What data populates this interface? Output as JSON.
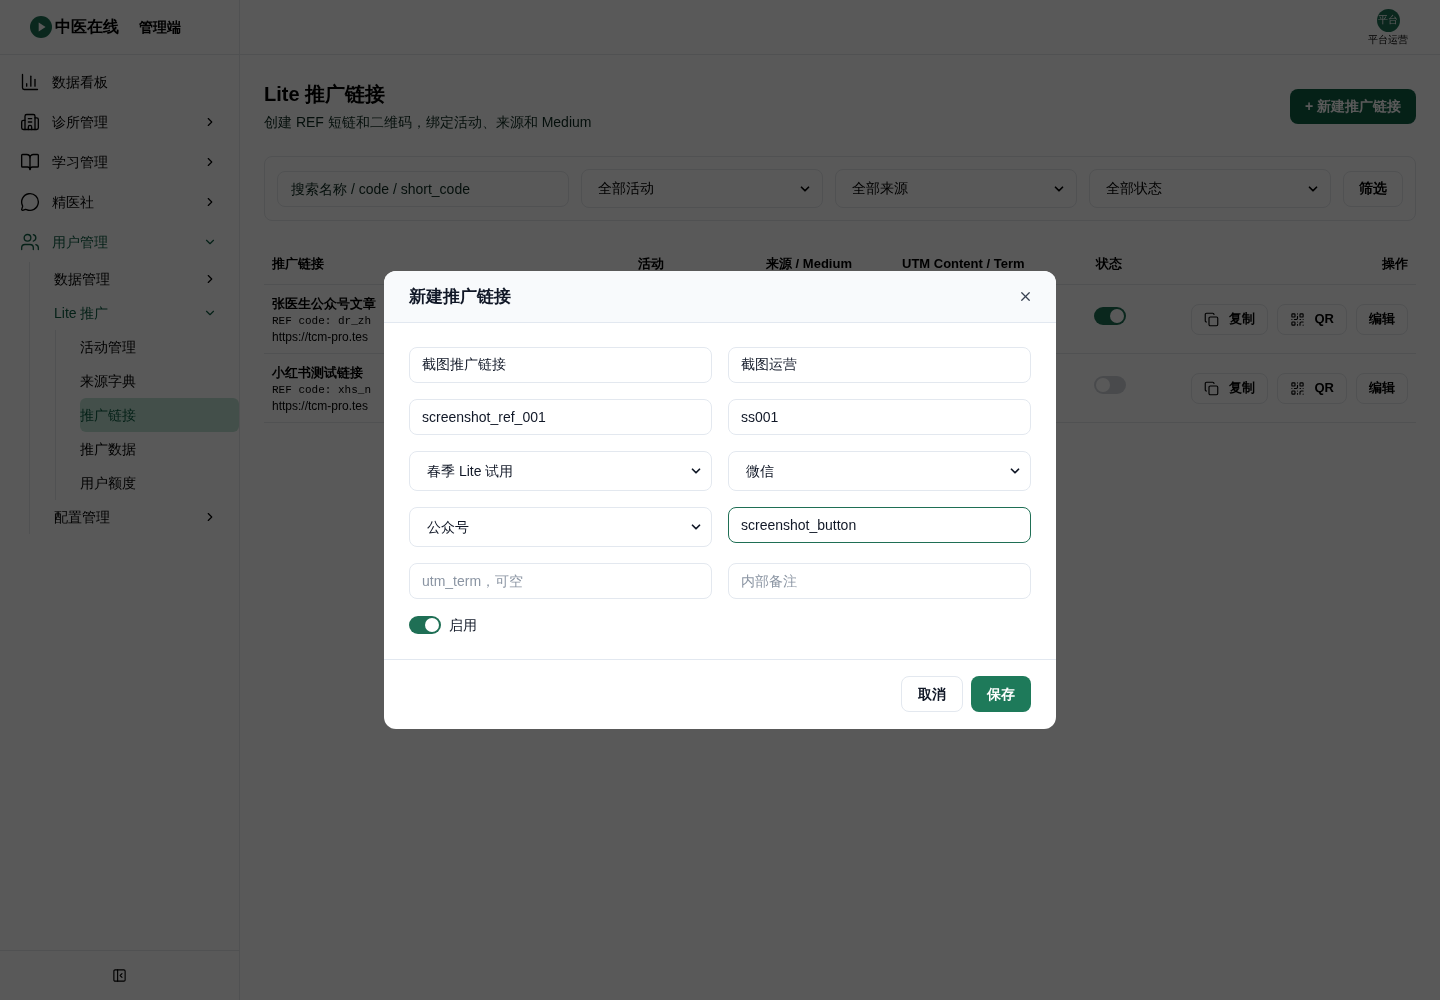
{
  "brand": {
    "name": "中医在线",
    "suffix": "管理端"
  },
  "user": {
    "avatar": "平台",
    "name": "平台运营"
  },
  "sidebar": {
    "items": [
      {
        "label": "数据看板",
        "selected": false
      },
      {
        "label": "诊所管理",
        "selected": false,
        "expanded": false
      },
      {
        "label": "学习管理",
        "selected": false,
        "expanded": false
      },
      {
        "label": "精医社",
        "selected": false,
        "expanded": false
      },
      {
        "label": "用户管理",
        "selected": false,
        "expanded": true,
        "children": [
          {
            "label": "数据管理",
            "selected": false,
            "expanded": false
          },
          {
            "label": "Lite 推广",
            "selected": false,
            "expanded": true,
            "children": [
              {
                "label": "活动管理",
                "selected": false
              },
              {
                "label": "来源字典",
                "selected": false
              },
              {
                "label": "推广链接",
                "selected": true
              },
              {
                "label": "推广数据",
                "selected": false
              },
              {
                "label": "用户额度",
                "selected": false
              }
            ]
          },
          {
            "label": "配置管理",
            "selected": false,
            "expanded": false
          }
        ]
      }
    ]
  },
  "page": {
    "title": "Lite 推广链接",
    "subtitle": "创建 REF 短链和二维码，绑定活动、来源和 Medium",
    "new_button": "+ 新建推广链接"
  },
  "filters": {
    "search": {
      "placeholder": "搜索名称 / code / short_code"
    },
    "selects": [
      "全部活动",
      "全部来源",
      "全部状态"
    ],
    "button": "筛选"
  },
  "table": {
    "columns": [
      "推广链接",
      "活动",
      "来源 / Medium",
      "UTM Content / Term",
      "状态",
      "操作"
    ],
    "rows": [
      {
        "title": "张医生公众号文章",
        "ref_code": "REF code: dr_zh",
        "url": "https://tcm-pro.tes",
        "enabled": true,
        "actions": [
          {
            "kind": "copy",
            "label": "复制"
          },
          {
            "kind": "qr",
            "label": "QR"
          },
          {
            "kind": "edit",
            "label": "编辑"
          }
        ]
      },
      {
        "title": "小红书测试链接",
        "ref_code": "REF code: xhs_n",
        "url": "https://tcm-pro.tes",
        "enabled": false,
        "actions": [
          {
            "kind": "copy",
            "label": "复制"
          },
          {
            "kind": "qr",
            "label": "QR"
          },
          {
            "kind": "edit",
            "label": "编辑"
          }
        ]
      }
    ]
  },
  "modal": {
    "title": "新建推广链接",
    "fields": [
      {
        "kind": "input",
        "value": "截图推广链接",
        "focused": false
      },
      {
        "kind": "input",
        "value": "截图运营",
        "focused": false
      },
      {
        "kind": "input",
        "value": "screenshot_ref_001",
        "focused": false
      },
      {
        "kind": "input",
        "value": "ss001",
        "focused": false
      },
      {
        "kind": "select",
        "value": "春季 Lite 试用",
        "focused": false
      },
      {
        "kind": "select",
        "value": "微信",
        "focused": false
      },
      {
        "kind": "select",
        "value": "公众号",
        "focused": false
      },
      {
        "kind": "input",
        "value": "screenshot_button",
        "focused": true
      },
      {
        "kind": "input",
        "placeholder": "utm_term，可空",
        "focused": false
      },
      {
        "kind": "input",
        "placeholder": "内部备注",
        "focused": false
      }
    ],
    "toggle": {
      "label": "启用",
      "on": true
    },
    "buttons": [
      {
        "kind": "secondary",
        "label": "取消"
      },
      {
        "kind": "primary",
        "label": "保存"
      }
    ]
  }
}
